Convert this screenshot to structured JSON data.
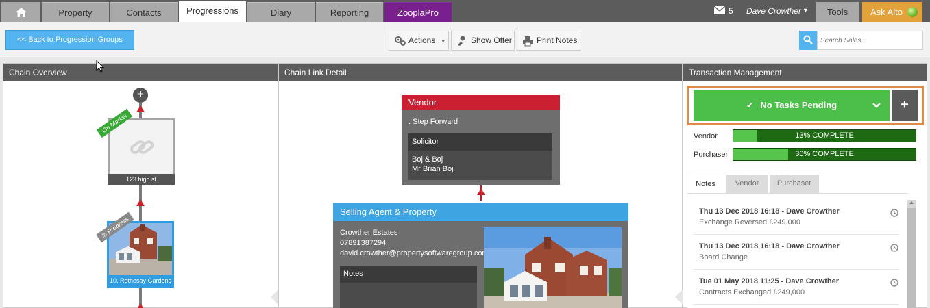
{
  "nav": {
    "tabs": [
      "Property",
      "Contacts",
      "Progressions",
      "Diary",
      "Reporting",
      "ZooplaPro"
    ],
    "mail_count": "5",
    "user_name": "Dave Crowther",
    "tools_label": "Tools",
    "ask_label": "Ask Alto"
  },
  "toolbar": {
    "back_label": "<< Back to Progression Groups",
    "actions_label": "Actions",
    "show_offer_label": "Show Offer",
    "print_notes_label": "Print Notes",
    "search_placeholder": "Search Sales..."
  },
  "chain_overview": {
    "title": "Chain Overview",
    "card1": {
      "status": "On Market",
      "address": "123 high st"
    },
    "card2": {
      "status": "In Progress",
      "address": "10, Rothesay Gardens"
    }
  },
  "chain_link": {
    "title": "Chain Link Detail",
    "vendor": {
      "title": "Vendor",
      "name": ". Step Forward",
      "solicitor_label": "Solicitor",
      "solicitor_firm": "Boj & Boj",
      "solicitor_contact": "Mr Brian Boj"
    },
    "agent": {
      "title": "Selling Agent & Property",
      "company": "Crowther Estates",
      "phone": "07891387294",
      "email": "david.crowther@propertysoftwaregroup.com",
      "notes_label": "Notes"
    }
  },
  "transaction": {
    "title": "Transaction Management",
    "tasks_label": "No Tasks Pending",
    "vendor_label": "Vendor",
    "vendor_progress": 13,
    "vendor_progress_text": "13% COMPLETE",
    "purchaser_label": "Purchaser",
    "purchaser_progress": 30,
    "purchaser_progress_text": "30% COMPLETE",
    "subtabs": [
      "Notes",
      "Vendor",
      "Purchaser"
    ],
    "notes": [
      {
        "title": "Thu 13 Dec 2018 16:18 - Dave Crowther",
        "detail": "Exchange Reversed £249,000"
      },
      {
        "title": "Thu 13 Dec 2018 16:18 - Dave Crowther",
        "detail": "Board Change"
      },
      {
        "title": "Tue 01 May 2018 11:25 - Dave Crowther",
        "detail": "Contracts Exchanged £249,000"
      }
    ]
  },
  "colors": {
    "vendor_red": "#cb2032",
    "agent_blue": "#3ea4e2",
    "tasks_green": "#4cbf4a",
    "ask_orange": "#e3a13a",
    "zoopla_purple": "#7a1f8e"
  },
  "icons": [
    "home-icon",
    "mail-icon",
    "gear-icon",
    "offer-icon",
    "print-icon",
    "search-icon",
    "check-icon",
    "chevron-down-icon",
    "plus-icon",
    "clock-icon",
    "link-icon",
    "status-orb-icon"
  ]
}
